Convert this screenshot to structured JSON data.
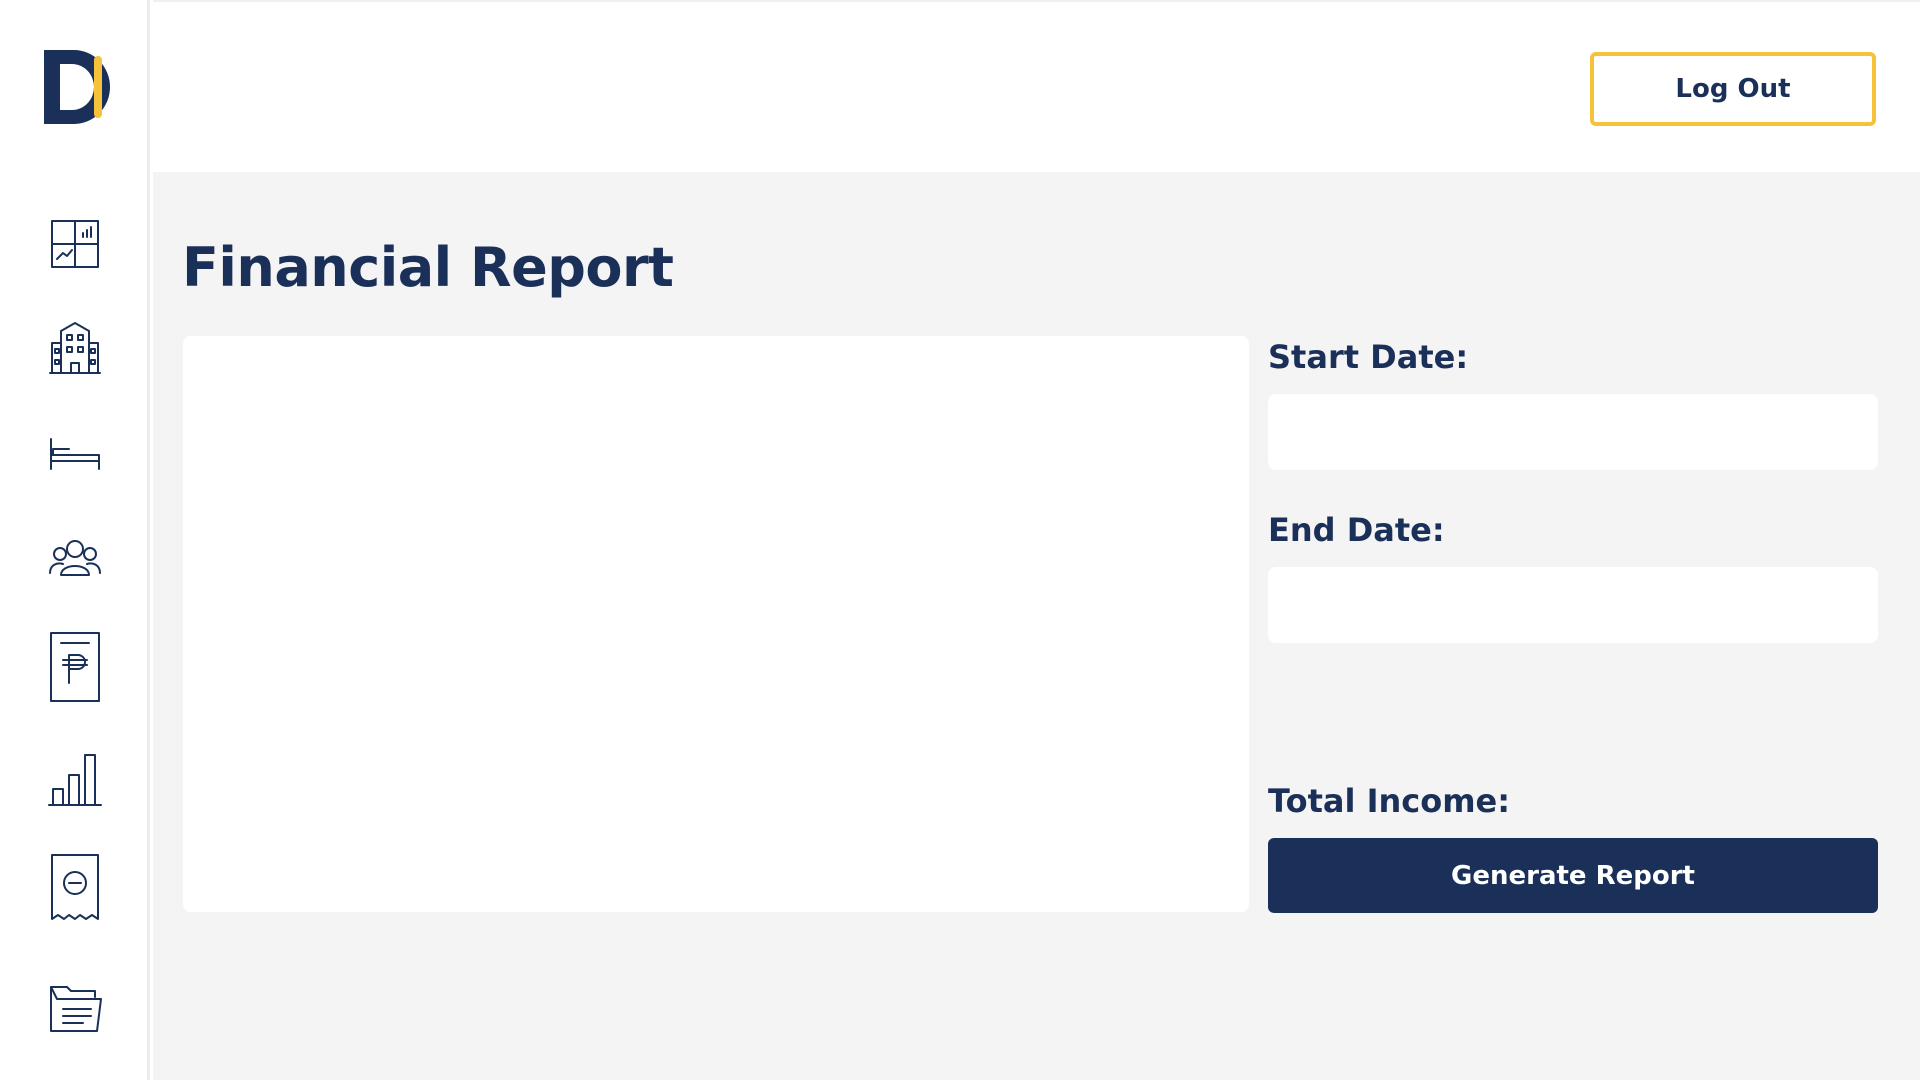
{
  "header": {
    "logout_label": "Log Out"
  },
  "main": {
    "title": "Financial Report",
    "start_date_label": "Start Date:",
    "start_date_value": "",
    "end_date_label": "End Date:",
    "end_date_value": "",
    "total_income_label": "Total Income:",
    "generate_label": "Generate Report"
  },
  "sidebar": {
    "items": [
      {
        "icon": "dashboard-icon"
      },
      {
        "icon": "building-icon"
      },
      {
        "icon": "bed-icon"
      },
      {
        "icon": "users-icon"
      },
      {
        "icon": "peso-document-icon"
      },
      {
        "icon": "bar-chart-icon"
      },
      {
        "icon": "receipt-minus-icon"
      },
      {
        "icon": "folder-icon"
      }
    ]
  },
  "colors": {
    "primary": "#1b3058",
    "accent": "#f6c23b",
    "background": "#f4f4f4",
    "panel": "#ffffff"
  }
}
